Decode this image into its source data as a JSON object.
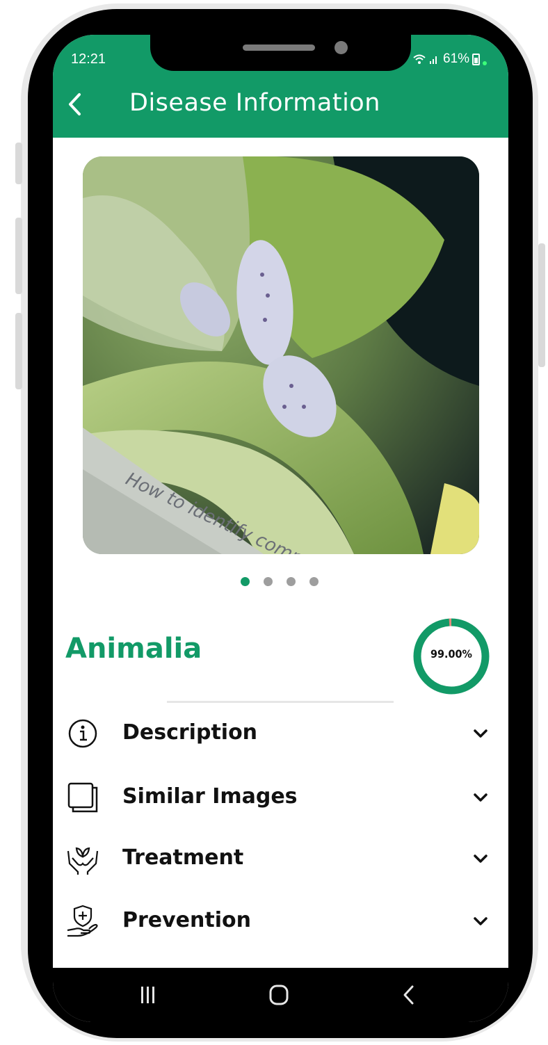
{
  "status_bar": {
    "time": "12:21",
    "battery_percent": "61%",
    "signal_text": "ᵂᴸ⸱ .ııl"
  },
  "app_bar": {
    "title": "Disease Information",
    "back_icon": "chevron-left-icon",
    "background_color": "#129a67"
  },
  "gallery": {
    "image_count": 4,
    "active_index": 0,
    "watermark_text": "How to identify comm"
  },
  "result": {
    "name": "Animalia",
    "confidence_label": "99.00%",
    "confidence_fraction": 0.99,
    "accent_color": "#129a67",
    "remainder_color": "#e2877a"
  },
  "sections": [
    {
      "label": "Description",
      "icon": "info-circle-icon"
    },
    {
      "label": "Similar Images",
      "icon": "images-stack-icon"
    },
    {
      "label": "Treatment",
      "icon": "hands-plant-icon"
    },
    {
      "label": "Prevention",
      "icon": "shield-hand-icon"
    }
  ],
  "nav_bar": {
    "recents_icon": "recents-icon",
    "home_icon": "home-icon",
    "back_icon": "back-icon"
  }
}
